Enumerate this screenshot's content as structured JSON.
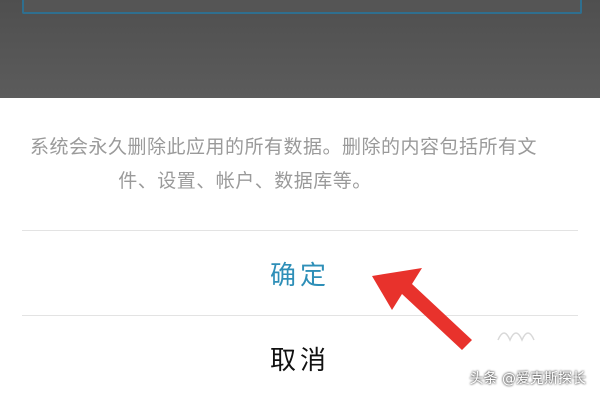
{
  "dialog": {
    "message_line1": "系统会永久删除此应用的所有数据。删除的内容包括所有文",
    "message_line2": "件、设置、帐户、数据库等。",
    "confirm_label": "确定",
    "cancel_label": "取消"
  },
  "watermark": {
    "text": "头条 @爱克斯探长"
  },
  "colors": {
    "confirm": "#2e8fb8",
    "cancel": "#111111",
    "message": "#9a9a9a",
    "arrow": "#e8322c",
    "overlay": "#5a5a5a"
  },
  "icons": {
    "annotation": "red-arrow-icon"
  }
}
